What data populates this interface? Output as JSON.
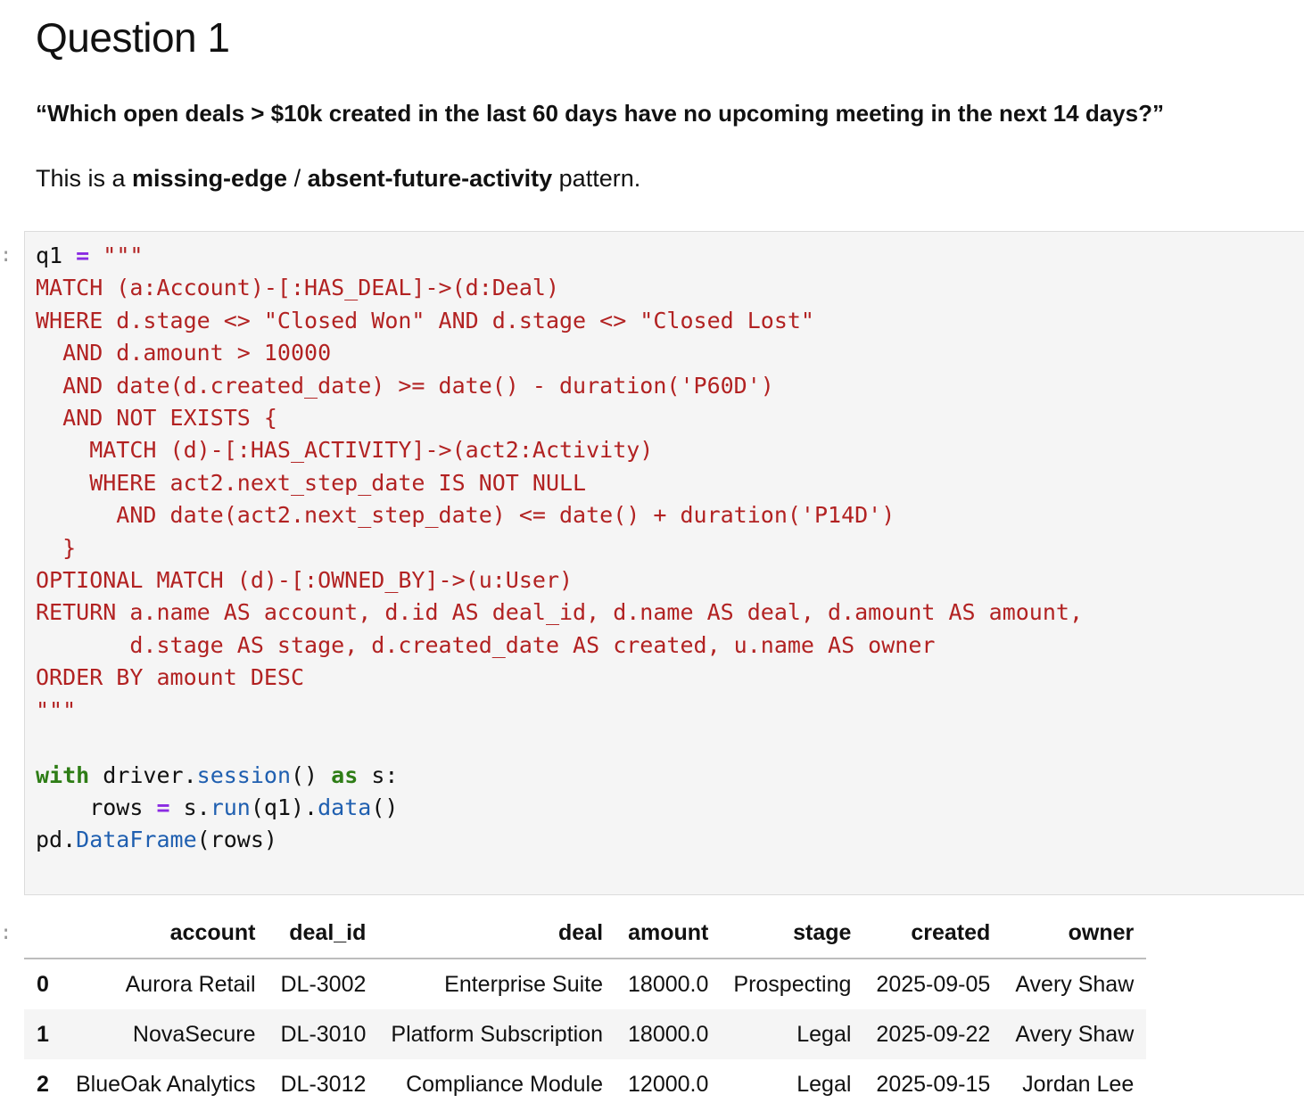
{
  "markdown": {
    "title": "Question 1",
    "quote": "“Which open deals > $10k created in the last 60 days have no upcoming meeting in the next 14 days?”",
    "para_prefix": "This is a ",
    "para_bold1": "missing-edge",
    "para_sep": " / ",
    "para_bold2": "absent-future-activity",
    "para_suffix": " pattern."
  },
  "code_cell": {
    "prompt": ":",
    "lines": {
      "l1_var": "q1 ",
      "l1_eq": "=",
      "l1_str": " \"\"\"",
      "l2": "MATCH (a:Account)-[:HAS_DEAL]->(d:Deal)",
      "l3": "WHERE d.stage <> \"Closed Won\" AND d.stage <> \"Closed Lost\"",
      "l4": "  AND d.amount > 10000",
      "l5": "  AND date(d.created_date) >= date() - duration('P60D')",
      "l6": "  AND NOT EXISTS {",
      "l7": "    MATCH (d)-[:HAS_ACTIVITY]->(act2:Activity)",
      "l8": "    WHERE act2.next_step_date IS NOT NULL",
      "l9": "      AND date(act2.next_step_date) <= date() + duration('P14D')",
      "l10": "  }",
      "l11": "OPTIONAL MATCH (d)-[:OWNED_BY]->(u:User)",
      "l12": "RETURN a.name AS account, d.id AS deal_id, d.name AS deal, d.amount AS amount,",
      "l13": "       d.stage AS stage, d.created_date AS created, u.name AS owner",
      "l14": "ORDER BY amount DESC",
      "l15": "\"\"\"",
      "l17_kw1": "with",
      "l17_a": " driver.",
      "l17_fn": "session",
      "l17_b": "() ",
      "l17_kw2": "as",
      "l17_c": " s:",
      "l18_a": "    rows ",
      "l18_eq": "=",
      "l18_b": " s.",
      "l18_fn1": "run",
      "l18_c": "(q1).",
      "l18_fn2": "data",
      "l18_d": "()",
      "l19_a": "pd.",
      "l19_fn": "DataFrame",
      "l19_b": "(rows)"
    }
  },
  "output": {
    "prompt": ":",
    "columns": [
      "",
      "account",
      "deal_id",
      "deal",
      "amount",
      "stage",
      "created",
      "owner"
    ],
    "rows": [
      [
        "0",
        "Aurora Retail",
        "DL-3002",
        "Enterprise Suite",
        "18000.0",
        "Prospecting",
        "2025-09-05",
        "Avery Shaw"
      ],
      [
        "1",
        "NovaSecure",
        "DL-3010",
        "Platform Subscription",
        "18000.0",
        "Legal",
        "2025-09-22",
        "Avery Shaw"
      ],
      [
        "2",
        "BlueOak Analytics",
        "DL-3012",
        "Compliance Module",
        "12000.0",
        "Legal",
        "2025-09-15",
        "Jordan Lee"
      ]
    ]
  }
}
